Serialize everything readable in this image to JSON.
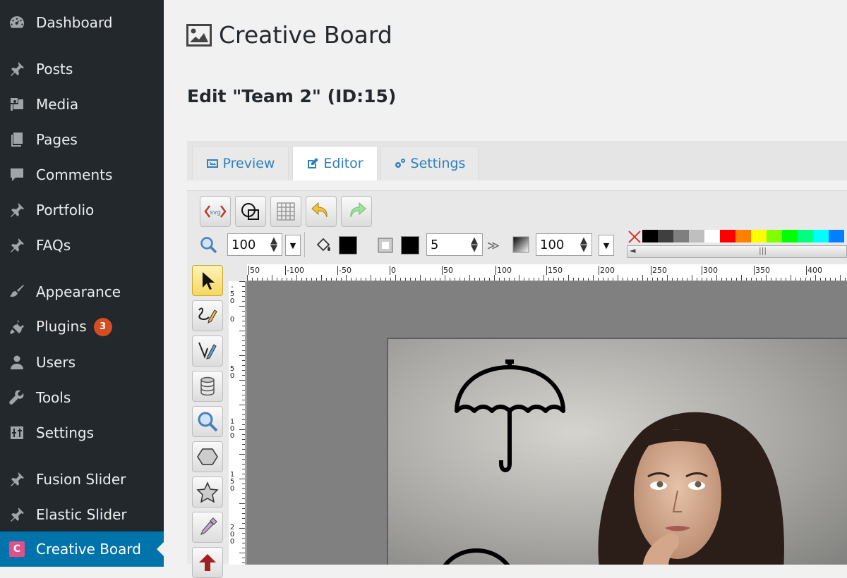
{
  "sidebar": {
    "items": [
      {
        "label": "Dashboard",
        "icon": "dashboard-icon"
      },
      {
        "label": "Posts",
        "icon": "pin-icon"
      },
      {
        "label": "Media",
        "icon": "media-icon"
      },
      {
        "label": "Pages",
        "icon": "pages-icon"
      },
      {
        "label": "Comments",
        "icon": "comments-icon"
      },
      {
        "label": "Portfolio",
        "icon": "pin-icon"
      },
      {
        "label": "FAQs",
        "icon": "pin-icon"
      },
      {
        "label": "Appearance",
        "icon": "brush-icon"
      },
      {
        "label": "Plugins",
        "icon": "plugin-icon",
        "badge": "3"
      },
      {
        "label": "Users",
        "icon": "user-icon"
      },
      {
        "label": "Tools",
        "icon": "wrench-icon"
      },
      {
        "label": "Settings",
        "icon": "settings-icon"
      },
      {
        "label": "Fusion Slider",
        "icon": "pin-icon"
      },
      {
        "label": "Elastic Slider",
        "icon": "pin-icon"
      },
      {
        "label": "Creative Board",
        "icon": "creative-board-icon",
        "logo_letter": "C",
        "active": true
      }
    ]
  },
  "header": {
    "title": "Creative Board",
    "edit_title": "Edit \"Team 2\" (ID:15)"
  },
  "tabs": [
    {
      "label": "Preview",
      "icon": "image-icon"
    },
    {
      "label": "Editor",
      "icon": "edit-icon",
      "active": true
    },
    {
      "label": "Settings",
      "icon": "gears-icon"
    }
  ],
  "toolbar": {
    "zoom_value": "100",
    "stroke_width_value": "5",
    "opacity_value": "100",
    "svg_label": "svg"
  },
  "ruler": {
    "top_ticks": [
      "50",
      "-100",
      "-50",
      "0",
      "50",
      "100",
      "150",
      "200",
      "250",
      "300",
      "350",
      "400"
    ],
    "left_ticks": [
      "-50",
      "0",
      "50",
      "100",
      "150",
      "200"
    ]
  },
  "colors": {
    "sidebar_bg": "#23282d",
    "active_bg": "#0073aa",
    "badge_bg": "#d54e21",
    "tab_link": "#2e7fbe",
    "palette": [
      "#000000",
      "#3f3f3f",
      "#7f7f7f",
      "#bfbfbf",
      "#ffffff",
      "#ff0000",
      "#ff7f00",
      "#ffff00",
      "#7fff00",
      "#00ff00",
      "#00ff7f",
      "#00ffff",
      "#007fff"
    ]
  }
}
